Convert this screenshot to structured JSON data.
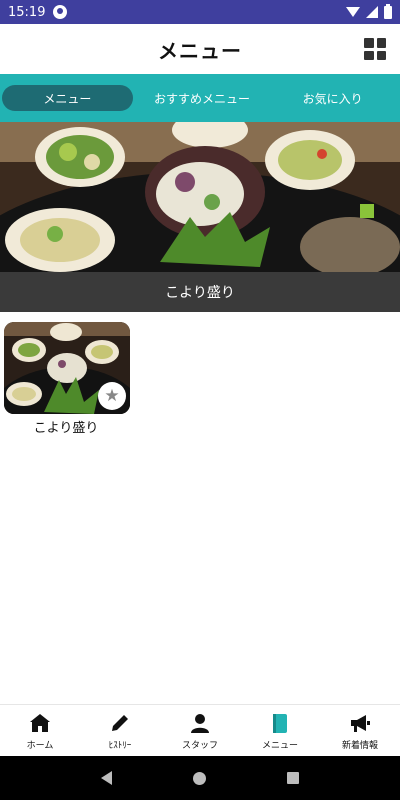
{
  "status_bar": {
    "time": "15:19",
    "icons": [
      "app-notification-icon",
      "wifi-icon",
      "signal-icon",
      "battery-icon"
    ]
  },
  "header": {
    "title": "メニュー",
    "grid_icon": "grid-view-icon"
  },
  "tabs": [
    {
      "label": "メニュー",
      "active": true
    },
    {
      "label": "おすすめメニュー",
      "active": false
    },
    {
      "label": "お気に入り",
      "active": false
    }
  ],
  "hero": {
    "caption": "こより盛り"
  },
  "menu_items": [
    {
      "label": "こより盛り",
      "favorite_icon": "star-icon"
    }
  ],
  "bottom_nav": [
    {
      "label": "ホーム",
      "icon": "home-icon",
      "active": false
    },
    {
      "label": "ﾋｽﾄﾘｰ",
      "icon": "pencil-icon",
      "active": false
    },
    {
      "label": "スタッフ",
      "icon": "person-icon",
      "active": false
    },
    {
      "label": "メニュー",
      "icon": "book-icon",
      "active": true
    },
    {
      "label": "新着情報",
      "icon": "megaphone-icon",
      "active": false
    }
  ],
  "colors": {
    "status_bar": "#3f3f9e",
    "accent": "#22b3b3",
    "active_tab": "#1e6b73"
  }
}
